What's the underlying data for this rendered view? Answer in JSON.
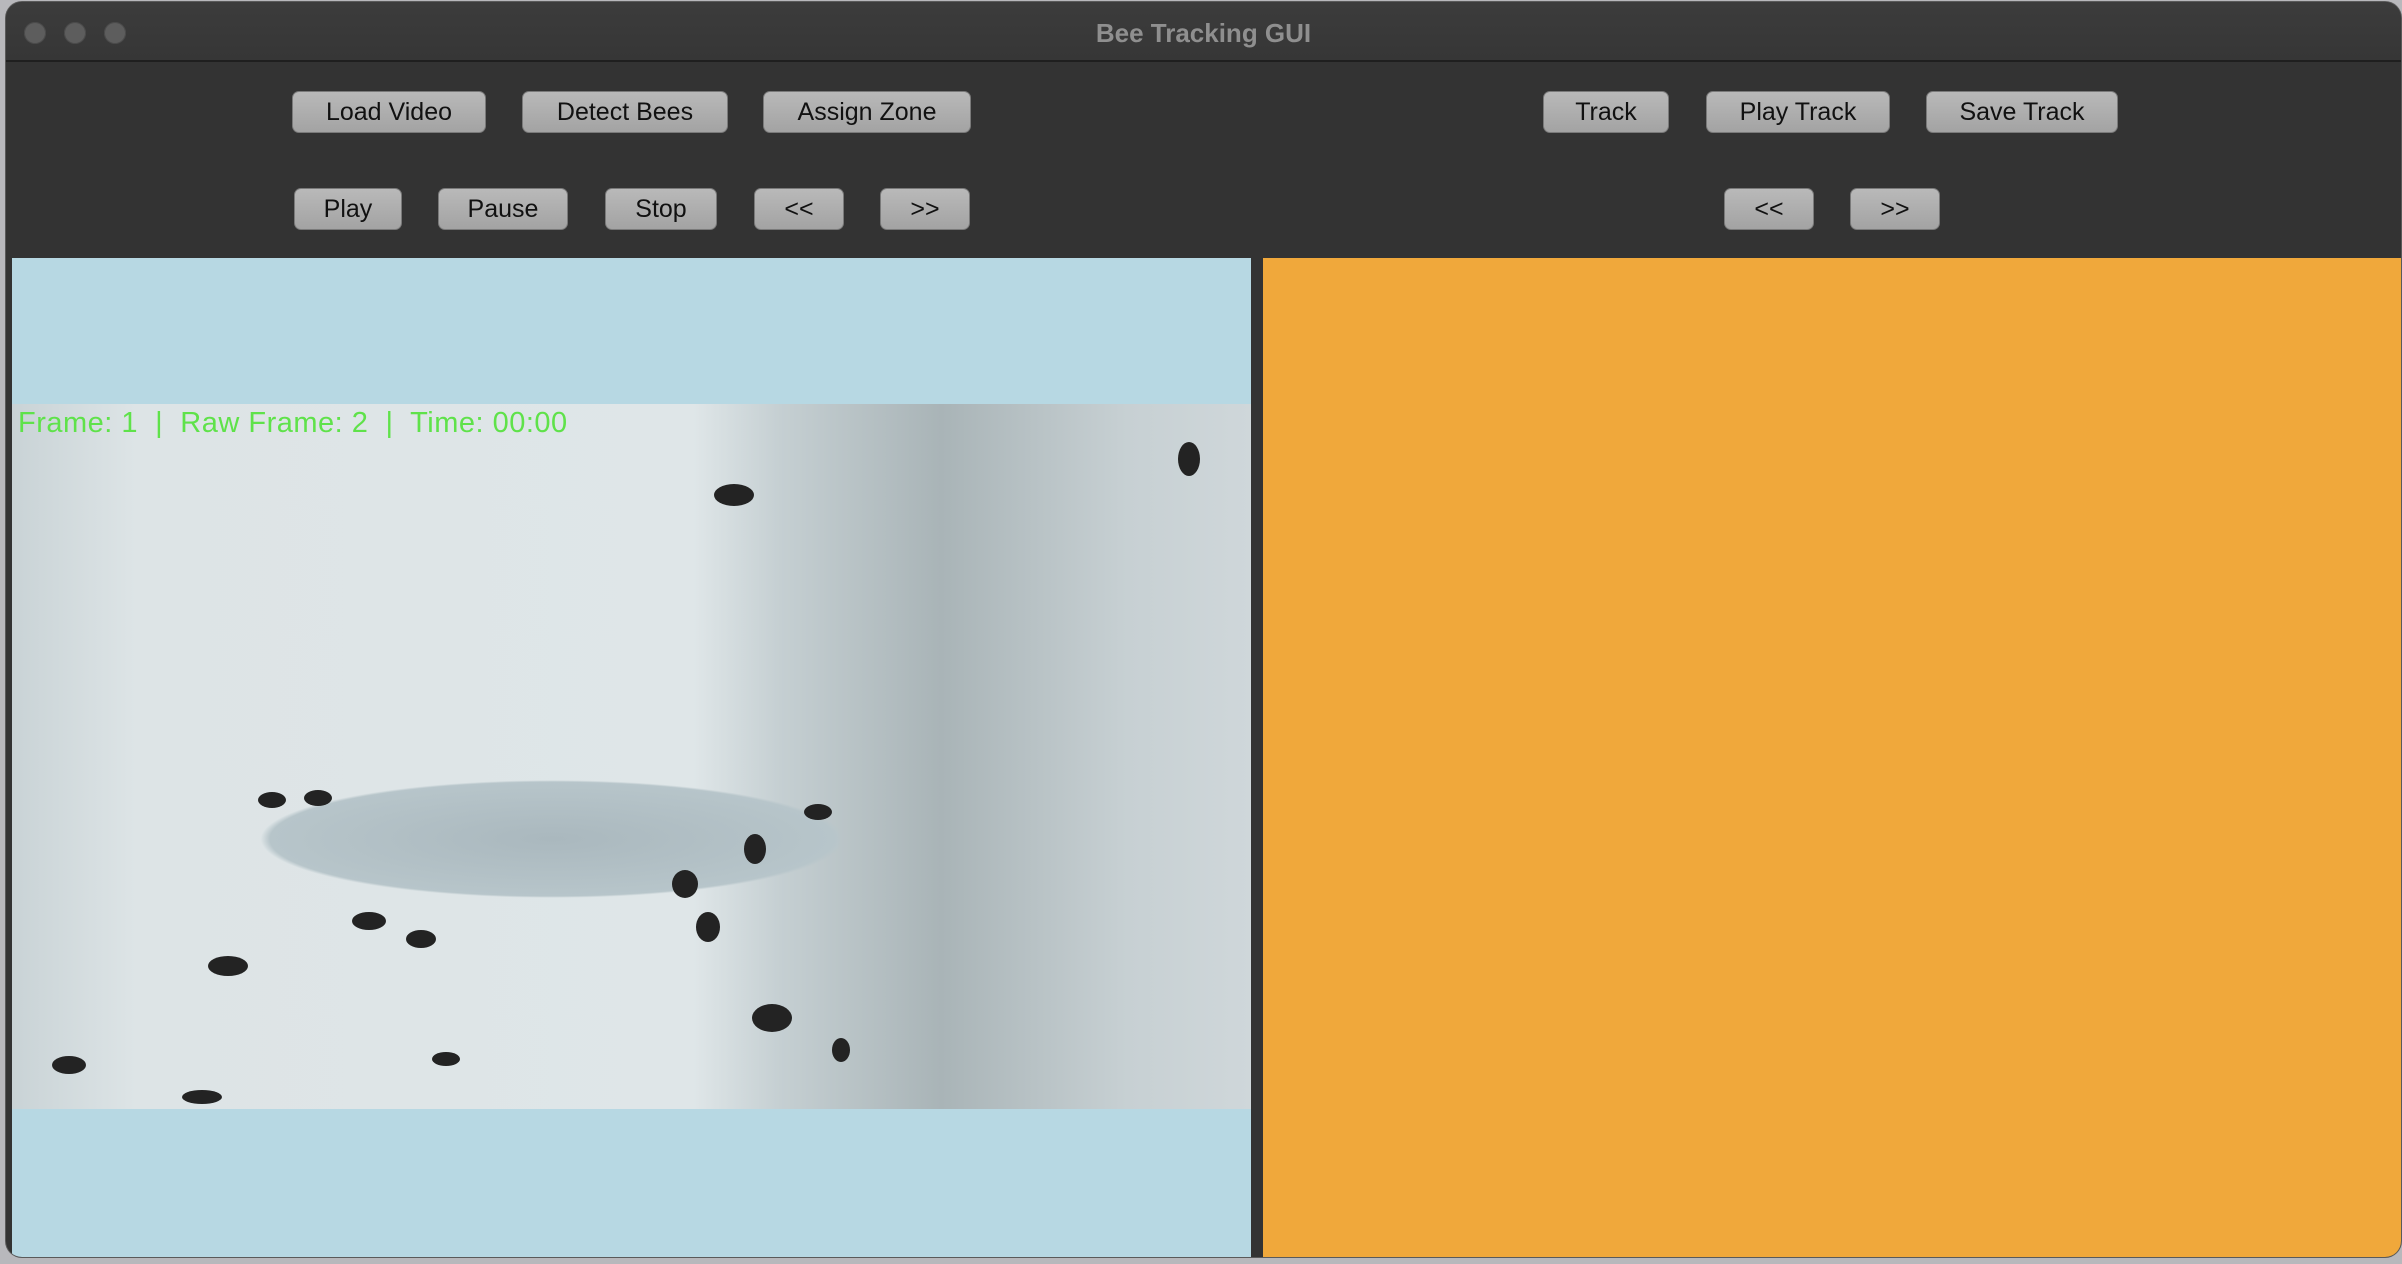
{
  "window": {
    "title": "Bee Tracking GUI"
  },
  "toolbar_left": {
    "row1": [
      "Load Video",
      "Detect Bees",
      "Assign Zone"
    ],
    "row2": [
      "Play",
      "Pause",
      "Stop",
      "<<",
      ">>"
    ]
  },
  "toolbar_right": {
    "row1": [
      "Track",
      "Play Track",
      "Save Track"
    ],
    "row2": [
      "<<",
      ">>"
    ]
  },
  "video": {
    "overlay_text": "Frame: 1  |  Raw Frame: 2  |  Time: 00:00"
  },
  "colors": {
    "window_bg": "#333333",
    "video_pane_bg": "#b7d8e3",
    "track_pane_bg": "#f0a83b",
    "overlay_text": "#5fe24a"
  }
}
